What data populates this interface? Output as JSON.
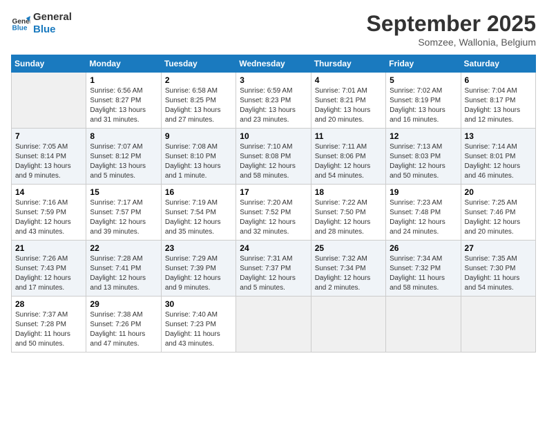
{
  "header": {
    "logo_line1": "General",
    "logo_line2": "Blue",
    "month_title": "September 2025",
    "location": "Somzee, Wallonia, Belgium"
  },
  "days_of_week": [
    "Sunday",
    "Monday",
    "Tuesday",
    "Wednesday",
    "Thursday",
    "Friday",
    "Saturday"
  ],
  "weeks": [
    [
      {
        "day": "",
        "sunrise": "",
        "sunset": "",
        "daylight": ""
      },
      {
        "day": "1",
        "sunrise": "Sunrise: 6:56 AM",
        "sunset": "Sunset: 8:27 PM",
        "daylight": "Daylight: 13 hours and 31 minutes."
      },
      {
        "day": "2",
        "sunrise": "Sunrise: 6:58 AM",
        "sunset": "Sunset: 8:25 PM",
        "daylight": "Daylight: 13 hours and 27 minutes."
      },
      {
        "day": "3",
        "sunrise": "Sunrise: 6:59 AM",
        "sunset": "Sunset: 8:23 PM",
        "daylight": "Daylight: 13 hours and 23 minutes."
      },
      {
        "day": "4",
        "sunrise": "Sunrise: 7:01 AM",
        "sunset": "Sunset: 8:21 PM",
        "daylight": "Daylight: 13 hours and 20 minutes."
      },
      {
        "day": "5",
        "sunrise": "Sunrise: 7:02 AM",
        "sunset": "Sunset: 8:19 PM",
        "daylight": "Daylight: 13 hours and 16 minutes."
      },
      {
        "day": "6",
        "sunrise": "Sunrise: 7:04 AM",
        "sunset": "Sunset: 8:17 PM",
        "daylight": "Daylight: 13 hours and 12 minutes."
      }
    ],
    [
      {
        "day": "7",
        "sunrise": "Sunrise: 7:05 AM",
        "sunset": "Sunset: 8:14 PM",
        "daylight": "Daylight: 13 hours and 9 minutes."
      },
      {
        "day": "8",
        "sunrise": "Sunrise: 7:07 AM",
        "sunset": "Sunset: 8:12 PM",
        "daylight": "Daylight: 13 hours and 5 minutes."
      },
      {
        "day": "9",
        "sunrise": "Sunrise: 7:08 AM",
        "sunset": "Sunset: 8:10 PM",
        "daylight": "Daylight: 13 hours and 1 minute."
      },
      {
        "day": "10",
        "sunrise": "Sunrise: 7:10 AM",
        "sunset": "Sunset: 8:08 PM",
        "daylight": "Daylight: 12 hours and 58 minutes."
      },
      {
        "day": "11",
        "sunrise": "Sunrise: 7:11 AM",
        "sunset": "Sunset: 8:06 PM",
        "daylight": "Daylight: 12 hours and 54 minutes."
      },
      {
        "day": "12",
        "sunrise": "Sunrise: 7:13 AM",
        "sunset": "Sunset: 8:03 PM",
        "daylight": "Daylight: 12 hours and 50 minutes."
      },
      {
        "day": "13",
        "sunrise": "Sunrise: 7:14 AM",
        "sunset": "Sunset: 8:01 PM",
        "daylight": "Daylight: 12 hours and 46 minutes."
      }
    ],
    [
      {
        "day": "14",
        "sunrise": "Sunrise: 7:16 AM",
        "sunset": "Sunset: 7:59 PM",
        "daylight": "Daylight: 12 hours and 43 minutes."
      },
      {
        "day": "15",
        "sunrise": "Sunrise: 7:17 AM",
        "sunset": "Sunset: 7:57 PM",
        "daylight": "Daylight: 12 hours and 39 minutes."
      },
      {
        "day": "16",
        "sunrise": "Sunrise: 7:19 AM",
        "sunset": "Sunset: 7:54 PM",
        "daylight": "Daylight: 12 hours and 35 minutes."
      },
      {
        "day": "17",
        "sunrise": "Sunrise: 7:20 AM",
        "sunset": "Sunset: 7:52 PM",
        "daylight": "Daylight: 12 hours and 32 minutes."
      },
      {
        "day": "18",
        "sunrise": "Sunrise: 7:22 AM",
        "sunset": "Sunset: 7:50 PM",
        "daylight": "Daylight: 12 hours and 28 minutes."
      },
      {
        "day": "19",
        "sunrise": "Sunrise: 7:23 AM",
        "sunset": "Sunset: 7:48 PM",
        "daylight": "Daylight: 12 hours and 24 minutes."
      },
      {
        "day": "20",
        "sunrise": "Sunrise: 7:25 AM",
        "sunset": "Sunset: 7:46 PM",
        "daylight": "Daylight: 12 hours and 20 minutes."
      }
    ],
    [
      {
        "day": "21",
        "sunrise": "Sunrise: 7:26 AM",
        "sunset": "Sunset: 7:43 PM",
        "daylight": "Daylight: 12 hours and 17 minutes."
      },
      {
        "day": "22",
        "sunrise": "Sunrise: 7:28 AM",
        "sunset": "Sunset: 7:41 PM",
        "daylight": "Daylight: 12 hours and 13 minutes."
      },
      {
        "day": "23",
        "sunrise": "Sunrise: 7:29 AM",
        "sunset": "Sunset: 7:39 PM",
        "daylight": "Daylight: 12 hours and 9 minutes."
      },
      {
        "day": "24",
        "sunrise": "Sunrise: 7:31 AM",
        "sunset": "Sunset: 7:37 PM",
        "daylight": "Daylight: 12 hours and 5 minutes."
      },
      {
        "day": "25",
        "sunrise": "Sunrise: 7:32 AM",
        "sunset": "Sunset: 7:34 PM",
        "daylight": "Daylight: 12 hours and 2 minutes."
      },
      {
        "day": "26",
        "sunrise": "Sunrise: 7:34 AM",
        "sunset": "Sunset: 7:32 PM",
        "daylight": "Daylight: 11 hours and 58 minutes."
      },
      {
        "day": "27",
        "sunrise": "Sunrise: 7:35 AM",
        "sunset": "Sunset: 7:30 PM",
        "daylight": "Daylight: 11 hours and 54 minutes."
      }
    ],
    [
      {
        "day": "28",
        "sunrise": "Sunrise: 7:37 AM",
        "sunset": "Sunset: 7:28 PM",
        "daylight": "Daylight: 11 hours and 50 minutes."
      },
      {
        "day": "29",
        "sunrise": "Sunrise: 7:38 AM",
        "sunset": "Sunset: 7:26 PM",
        "daylight": "Daylight: 11 hours and 47 minutes."
      },
      {
        "day": "30",
        "sunrise": "Sunrise: 7:40 AM",
        "sunset": "Sunset: 7:23 PM",
        "daylight": "Daylight: 11 hours and 43 minutes."
      },
      {
        "day": "",
        "sunrise": "",
        "sunset": "",
        "daylight": ""
      },
      {
        "day": "",
        "sunrise": "",
        "sunset": "",
        "daylight": ""
      },
      {
        "day": "",
        "sunrise": "",
        "sunset": "",
        "daylight": ""
      },
      {
        "day": "",
        "sunrise": "",
        "sunset": "",
        "daylight": ""
      }
    ]
  ]
}
